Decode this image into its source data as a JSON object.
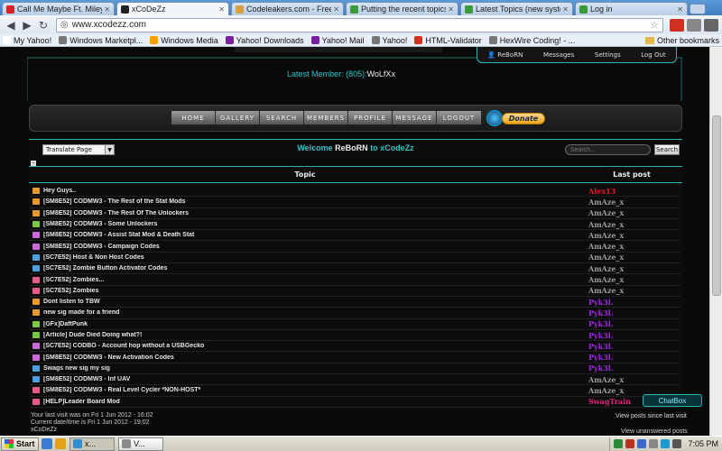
{
  "browser": {
    "tabs": [
      {
        "title": "Call Me Maybe Ft. Miley C",
        "favicon_color": "#e02020",
        "active": false
      },
      {
        "title": "xCoDeZz",
        "favicon_color": "#222222",
        "active": true
      },
      {
        "title": "Codeleakers.com - Free",
        "favicon_color": "#d8a040",
        "active": false
      },
      {
        "title": "Putting the recent topics",
        "favicon_color": "#3a9a3a",
        "active": false
      },
      {
        "title": "Latest Topics (new syste",
        "favicon_color": "#3a9a3a",
        "active": false
      },
      {
        "title": "Log in",
        "favicon_color": "#3a9a3a",
        "active": false
      }
    ],
    "url": "www.xcodezz.com",
    "bookmarks": [
      {
        "label": "My Yahoo!",
        "color": "#ffffff"
      },
      {
        "label": "Windows Marketpl...",
        "color": "#777777"
      },
      {
        "label": "Windows Media",
        "color": "#ff9c00"
      },
      {
        "label": "Yahoo! Downloads",
        "color": "#7b1fa2"
      },
      {
        "label": "Yahoo! Mail",
        "color": "#7b1fa2"
      },
      {
        "label": "Yahoo!",
        "color": "#777777"
      },
      {
        "label": "HTML-Validator",
        "color": "#d03020"
      },
      {
        "label": "HexWire Coding! - ...",
        "color": "#777777"
      }
    ],
    "other_bookmarks": "Other bookmarks"
  },
  "site": {
    "user_menu": {
      "username": "ReBoRN",
      "messages": "Messages",
      "settings": "Settings",
      "logout": "Log Out"
    },
    "latest_member_label": "Latest Member: (805):",
    "latest_member_name": "WoLfXx",
    "nav": [
      "HOME",
      "GALLERY",
      "SEARCH",
      "MEMBERS",
      "PROFILE",
      "MESSAGE",
      "LOGOUT"
    ],
    "donate_label": "Donate",
    "translate_label": "Translate Page",
    "welcome_prefix": "Welcome ",
    "welcome_user": "ReBoRN",
    "welcome_suffix": " to xCodeZz",
    "search_placeholder": "Search...",
    "search_button": "Search",
    "collapse_symbol": "–",
    "table": {
      "headers": {
        "topic": "Topic",
        "last_post": "Last post"
      },
      "rows": [
        {
          "topic": "Hey Guys..",
          "last": "Alex13",
          "icon_color": "#e89a2a",
          "last_color": "#e02020"
        },
        {
          "topic": "[SM8E52] CODMW3 - The Rest of the Stat Mods",
          "last": "AmAze_x",
          "icon_color": "#e89a2a",
          "last_color": "#9a9a9a"
        },
        {
          "topic": "[SM8E52] CODMW3 - The Rest Of The Unlockers",
          "last": "AmAze_x",
          "icon_color": "#e89a2a",
          "last_color": "#9a9a9a"
        },
        {
          "topic": "[SM8E52] CODMW3 - Some Unlockers",
          "last": "AmAze_x",
          "icon_color": "#7ac943",
          "last_color": "#9a9a9a"
        },
        {
          "topic": "[SM8E52] CODMW3 - Assist Stat Mod & Death Stat",
          "last": "AmAze_x",
          "icon_color": "#c86ad8",
          "last_color": "#9a9a9a"
        },
        {
          "topic": "[SM8E52] CODMW3 - Campaign Codes",
          "last": "AmAze_x",
          "icon_color": "#c86ad8",
          "last_color": "#9a9a9a"
        },
        {
          "topic": "[SC7E52] Host & Non Host Codes",
          "last": "AmAze_x",
          "icon_color": "#4aa3df",
          "last_color": "#9a9a9a"
        },
        {
          "topic": "[SC7E52] Zombie Button Activator Codes",
          "last": "AmAze_x",
          "icon_color": "#4aa3df",
          "last_color": "#9a9a9a"
        },
        {
          "topic": "[SC7E52] Zombies...",
          "last": "AmAze_x",
          "icon_color": "#e85a8a",
          "last_color": "#9a9a9a"
        },
        {
          "topic": "[SC7E52] Zombies",
          "last": "AmAze_x",
          "icon_color": "#e85a8a",
          "last_color": "#9a9a9a"
        },
        {
          "topic": "Dont listen to TBW",
          "last": "Pyk3l.",
          "icon_color": "#e89a2a",
          "last_color": "#9a2ad8"
        },
        {
          "topic": "new sig made for a friend",
          "last": "Pyk3l.",
          "icon_color": "#e89a2a",
          "last_color": "#9a2ad8"
        },
        {
          "topic": "[GFx]DaftPunk",
          "last": "Pyk3l.",
          "icon_color": "#7ac943",
          "last_color": "#9a2ad8"
        },
        {
          "topic": "[Article] Dude Died Doing what?!",
          "last": "Pyk3l.",
          "icon_color": "#7ac943",
          "last_color": "#9a2ad8"
        },
        {
          "topic": "[SC7E52] CODBO - Account hop without a USBGecko",
          "last": "Pyk3l.",
          "icon_color": "#c86ad8",
          "last_color": "#9a2ad8"
        },
        {
          "topic": "[SM8E52] CODMW3 - New Activation Codes",
          "last": "Pyk3l.",
          "icon_color": "#c86ad8",
          "last_color": "#9a2ad8"
        },
        {
          "topic": "Swags new sig my sig",
          "last": "Pyk3l.",
          "icon_color": "#4aa3df",
          "last_color": "#9a2ad8"
        },
        {
          "topic": "[SM8E52] CODMW3 - Inf UAV",
          "last": "AmAze_x",
          "icon_color": "#4aa3df",
          "last_color": "#9a9a9a"
        },
        {
          "topic": "[SM8E52] CODMW3 - Real Level Cycler *NON-HOST*",
          "last": "AmAze_x",
          "icon_color": "#e85a8a",
          "last_color": "#9a9a9a"
        },
        {
          "topic": "[HELP]Leader Board Mod",
          "last": "SwagTrain",
          "icon_color": "#e85a8a",
          "last_color": "#e0207a"
        }
      ]
    },
    "footer": {
      "last_visit": "Your last visit was on Fri 1 Jun 2012 - 16:02",
      "current_time": "Current date/time is Fri 1 Jun 2012 - 19:02",
      "site_name": "xCoDeZz",
      "view_posts": "View posts since last visit",
      "view_unanswered": "View unanswered posts"
    },
    "chatbox_label": "ChatBox"
  },
  "taskbar": {
    "start": "Start",
    "tasks": [
      {
        "label": "x...",
        "color": "#2f8fd0",
        "pressed": true
      },
      {
        "label": "V...",
        "color": "#8a8a8a",
        "pressed": false
      }
    ],
    "clock": "7:05 PM"
  }
}
